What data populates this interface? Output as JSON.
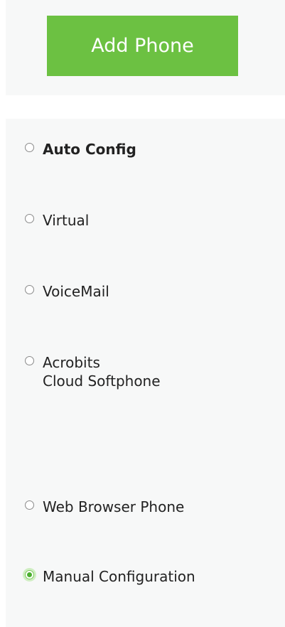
{
  "add_phone_button": {
    "label": "Add Phone"
  },
  "options": [
    {
      "label": "Auto Config",
      "selected": false
    },
    {
      "label": "Virtual",
      "selected": false
    },
    {
      "label": "VoiceMail",
      "selected": false
    },
    {
      "label_line1": "Acrobits",
      "label_line2": "Cloud Softphone",
      "selected": false
    },
    {
      "label": "Web Browser Phone",
      "selected": false
    },
    {
      "label": "Manual Configuration",
      "selected": true
    }
  ],
  "colors": {
    "button_green": "#6cc142",
    "panel_background": "#f7f8f8",
    "selected_radio": "#4caf30"
  }
}
